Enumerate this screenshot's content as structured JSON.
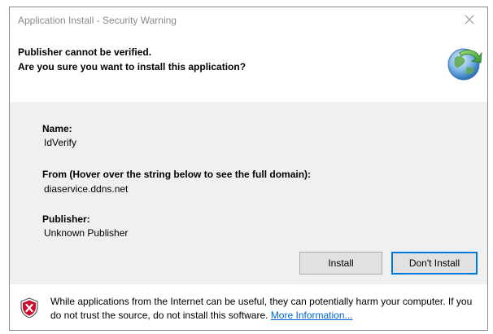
{
  "window": {
    "title": "Application Install - Security Warning",
    "close_icon": "close-icon"
  },
  "header": {
    "line1": "Publisher cannot be verified.",
    "line2": "Are you sure you want to install this application?",
    "icon": "app-install-icon"
  },
  "details": {
    "name_label": "Name:",
    "name_value": "IdVerify",
    "from_label": "From (Hover over the string below to see the full domain):",
    "from_value": "diaservice.ddns.net",
    "publisher_label": "Publisher:",
    "publisher_value": "Unknown Publisher"
  },
  "buttons": {
    "install": "Install",
    "dont_install": "Don't Install"
  },
  "footer": {
    "icon": "shield-warning-icon",
    "warning_text": "While applications from the Internet can be useful, they can potentially harm your computer. If you do not trust the source, do not install this software. ",
    "more_info_link": "More Information..."
  },
  "colors": {
    "accent": "#0078d7",
    "link": "#0066cc",
    "info_background": "#f0f0f0",
    "shield_red": "#c8102e"
  }
}
